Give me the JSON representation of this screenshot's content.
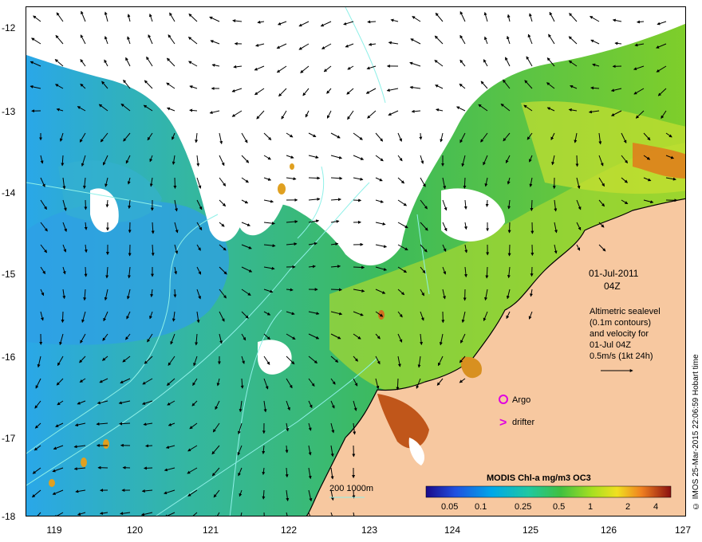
{
  "map": {
    "date": "01-Jul-2011",
    "time": "04Z",
    "legend_text": [
      "Altimetric sealevel",
      "(0.1m contours)",
      "and velocity for",
      "01-Jul 04Z",
      "0.5m/s (1kt 24h)"
    ],
    "argo_label": "Argo",
    "drifter_label": "drifter",
    "drifter_symbol": ">",
    "colorbar_title": "MODIS Chl-a mg/m3 OC3",
    "colorbar_ticks": [
      "0.05",
      "0.1",
      "0.25",
      "0.5",
      "1",
      "2",
      "4"
    ],
    "bathy_label": "200  1000m",
    "credit": "© IMOS 25-Mar-2015 22:06:59 Hobart time",
    "lat_labels": [
      "-12",
      "-13",
      "-14",
      "-15",
      "-16",
      "-17",
      "-18"
    ],
    "lon_labels": [
      "119",
      "120",
      "121",
      "122",
      "123",
      "124",
      "125",
      "126",
      "127"
    ],
    "colors": {
      "land": "#f7c8a0",
      "cloud": "#ffffff",
      "chl_low": "#1e90ff",
      "chl_mid": "#3cb371",
      "chl_high": "#d2691e",
      "contour": "#7fffd4",
      "vector": "#000000",
      "marker": "#ff00ff"
    },
    "icons": {
      "velocity_vector": "arrow-icon",
      "argo_marker": "circle-marker-icon",
      "drifter_marker": "chevron-marker-icon"
    }
  }
}
